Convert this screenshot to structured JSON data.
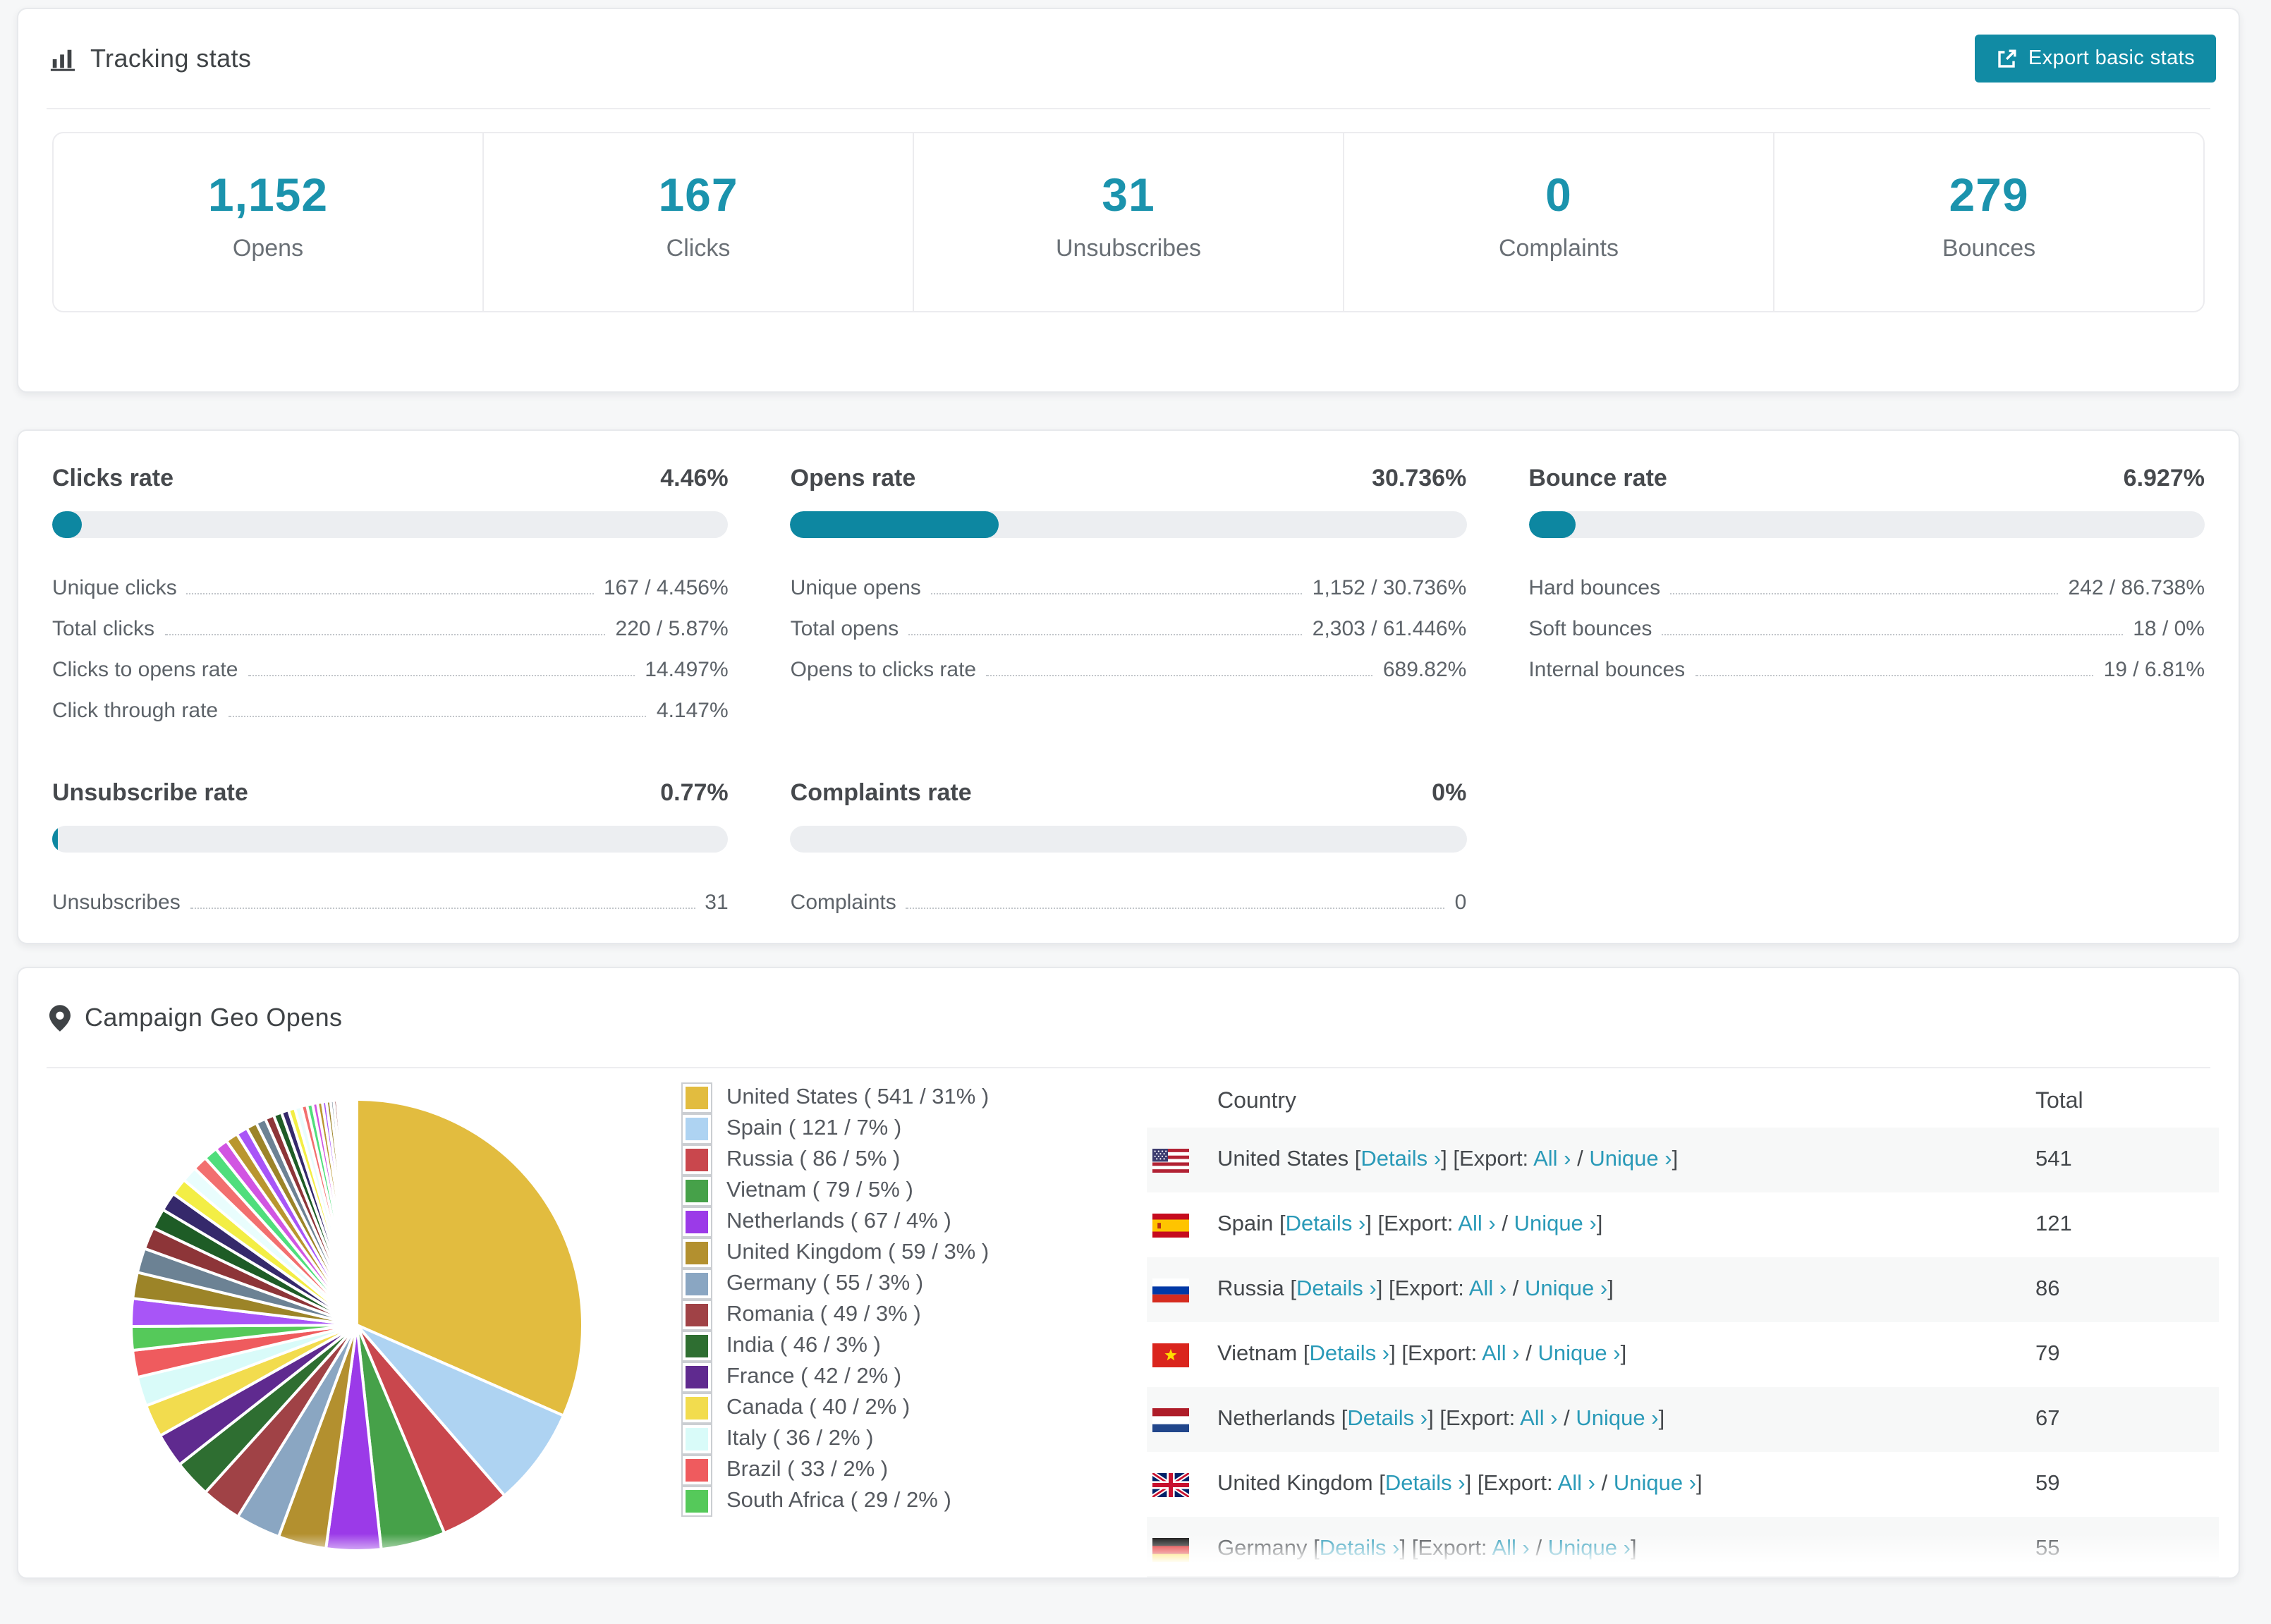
{
  "colors": {
    "accent": "#118ba4",
    "stat_number": "#1b93ad",
    "progress_fill": "#0d87a1",
    "link": "#2a9ab8",
    "row_stripe": "#f7f8f8"
  },
  "header": {
    "title": "Tracking stats",
    "export_button": "Export basic stats"
  },
  "summary_stats": [
    {
      "value": "1,152",
      "label": "Opens"
    },
    {
      "value": "167",
      "label": "Clicks"
    },
    {
      "value": "31",
      "label": "Unsubscribes"
    },
    {
      "value": "0",
      "label": "Complaints"
    },
    {
      "value": "279",
      "label": "Bounces"
    }
  ],
  "rate_blocks": [
    {
      "id": "clicks",
      "title": "Clicks rate",
      "value": "4.46%",
      "progress_pct": 4.46,
      "rows": [
        {
          "label": "Unique clicks",
          "value": "167 / 4.456%"
        },
        {
          "label": "Total clicks",
          "value": "220 / 5.87%"
        },
        {
          "label": "Clicks to opens rate",
          "value": "14.497%"
        },
        {
          "label": "Click through rate",
          "value": "4.147%"
        }
      ]
    },
    {
      "id": "opens",
      "title": "Opens rate",
      "value": "30.736%",
      "progress_pct": 30.736,
      "rows": [
        {
          "label": "Unique opens",
          "value": "1,152 / 30.736%"
        },
        {
          "label": "Total opens",
          "value": "2,303 / 61.446%"
        },
        {
          "label": "Opens to clicks rate",
          "value": "689.82%"
        }
      ]
    },
    {
      "id": "bounce",
      "title": "Bounce rate",
      "value": "6.927%",
      "progress_pct": 6.927,
      "rows": [
        {
          "label": "Hard bounces",
          "value": "242 / 86.738%"
        },
        {
          "label": "Soft bounces",
          "value": "18 / 0%"
        },
        {
          "label": "Internal bounces",
          "value": "19 / 6.81%"
        }
      ]
    },
    {
      "id": "unsubscribe",
      "title": "Unsubscribe rate",
      "value": "0.77%",
      "progress_pct": 0.77,
      "rows": [
        {
          "label": "Unsubscribes",
          "value": "31"
        }
      ]
    },
    {
      "id": "complaints",
      "title": "Complaints rate",
      "value": "0%",
      "progress_pct": 0,
      "rows": [
        {
          "label": "Complaints",
          "value": "0"
        }
      ]
    }
  ],
  "geo": {
    "title": "Campaign Geo Opens",
    "chart_data": {
      "type": "pie",
      "title": "Campaign Geo Opens",
      "legend_position": "right",
      "start_angle_deg": -90,
      "direction": "clockwise",
      "slices": [
        {
          "label": "United States",
          "value": 541,
          "pct": 31,
          "color": "#e2bc3f"
        },
        {
          "label": "Spain",
          "value": 121,
          "pct": 7,
          "color": "#aed3f2"
        },
        {
          "label": "Russia",
          "value": 86,
          "pct": 5,
          "color": "#c9474d"
        },
        {
          "label": "Vietnam",
          "value": 79,
          "pct": 5,
          "color": "#46a149"
        },
        {
          "label": "Netherlands",
          "value": 67,
          "pct": 4,
          "color": "#9b3ae8"
        },
        {
          "label": "United Kingdom",
          "value": 59,
          "pct": 3,
          "color": "#b3902f"
        },
        {
          "label": "Germany",
          "value": 55,
          "pct": 3,
          "color": "#8aa6c2"
        },
        {
          "label": "Romania",
          "value": 49,
          "pct": 3,
          "color": "#a04246"
        },
        {
          "label": "India",
          "value": 46,
          "pct": 3,
          "color": "#2e6e31"
        },
        {
          "label": "France",
          "value": 42,
          "pct": 2,
          "color": "#5f2a8f"
        },
        {
          "label": "Canada",
          "value": 40,
          "pct": 2,
          "color": "#f2dc4e"
        },
        {
          "label": "Italy",
          "value": 36,
          "pct": 2,
          "color": "#d9fbf9"
        },
        {
          "label": "Brazil",
          "value": 33,
          "pct": 2,
          "color": "#ef5b5e"
        },
        {
          "label": "South Africa",
          "value": 29,
          "pct": 2,
          "color": "#55c95a"
        }
      ],
      "other_slices_values": [
        34,
        32,
        30,
        27,
        25,
        23,
        21,
        19,
        18,
        17,
        16,
        15,
        14,
        13,
        12,
        11,
        10,
        9,
        8,
        8,
        7,
        7,
        6,
        6,
        5,
        5,
        4,
        4,
        3,
        3,
        3,
        2,
        2,
        2,
        2,
        1,
        1,
        1,
        1,
        1,
        1,
        1
      ],
      "other_slices_colors": [
        "#a855f7",
        "#9c8428",
        "#6c8294",
        "#8d3538",
        "#1e5c26",
        "#35296b",
        "#f3ee45",
        "#e9fdfd",
        "#f26f6f",
        "#50de7c",
        "#d155e2",
        "#b9962f"
      ]
    },
    "table": {
      "col_country": "Country",
      "col_total": "Total",
      "link_details": "Details",
      "label_export": "Export:",
      "link_all": "All",
      "link_unique": "Unique",
      "rows": [
        {
          "country": "United States",
          "flag": "us",
          "total": "541"
        },
        {
          "country": "Spain",
          "flag": "es",
          "total": "121"
        },
        {
          "country": "Russia",
          "flag": "ru",
          "total": "86"
        },
        {
          "country": "Vietnam",
          "flag": "vn",
          "total": "79"
        },
        {
          "country": "Netherlands",
          "flag": "nl",
          "total": "67"
        },
        {
          "country": "United Kingdom",
          "flag": "gb",
          "total": "59"
        },
        {
          "country": "Germany",
          "flag": "de",
          "total": "55"
        }
      ]
    }
  }
}
